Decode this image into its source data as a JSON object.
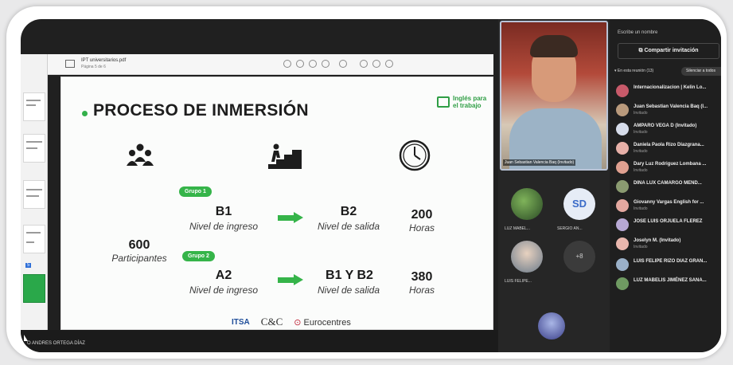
{
  "document": {
    "file_name": "IPT universitarios.pdf",
    "page_info": "Página 5 de 6"
  },
  "slide": {
    "title": "PROCESO DE INMERSIÓN",
    "brand": "Inglés para el trabajo",
    "participants_count": "600",
    "participants_label": "Participantes",
    "groups": [
      {
        "label": "Grupo 1",
        "entry_level": "B1",
        "entry_caption": "Nivel de ingreso",
        "exit_level": "B2",
        "exit_caption": "Nivel de salida",
        "hours": "200",
        "hours_caption": "Horas"
      },
      {
        "label": "Grupo 2",
        "entry_level": "A2",
        "entry_caption": "Nivel de ingreso",
        "exit_level": "B1 Y B2",
        "exit_caption": "Nivel de salida",
        "hours": "380",
        "hours_caption": "Horas"
      }
    ],
    "logos": [
      "ITSA",
      "C&C",
      "Eurocentres"
    ],
    "icons": [
      "people-group-icon",
      "stairs-climb-icon",
      "clock-icon"
    ]
  },
  "presenter": {
    "name": "O ANDRES ORTEGA DÍAZ"
  },
  "videos": {
    "main_label": "Juan Sebastian Valencia Baq (Invitado)",
    "tiles": [
      {
        "name": "LUZ MABEL..."
      },
      {
        "name": "SERGIO AN...",
        "initials": "SD"
      },
      {
        "name": "LUIS FELIPE..."
      },
      {
        "name": "",
        "initials": "+8"
      }
    ]
  },
  "participants_panel": {
    "search_placeholder": "Escribe un nombre",
    "invite_button": "Compartir invitación",
    "in_meeting": "En esta reunión (13)",
    "mute_all": "Silenciar a todos",
    "people": [
      {
        "name": "Internacionalizacion | Kelin Lo...",
        "role": ""
      },
      {
        "name": "Juan Sebastian Valencia Baq (I...",
        "role": "Invitado"
      },
      {
        "name": "AMPARO VEGA D (Invitado)",
        "role": "Invitado"
      },
      {
        "name": "Daniela Paola Rizo Diazgrana...",
        "role": "Invitado"
      },
      {
        "name": "Dary Luz Rodriguez Lombana ...",
        "role": "Invitado"
      },
      {
        "name": "DINA LUX CAMARGO MEND...",
        "role": ""
      },
      {
        "name": "Giovanny Vargas English for ...",
        "role": "Invitado"
      },
      {
        "name": "JOSE LUIS ORJUELA FLEREZ",
        "role": ""
      },
      {
        "name": "Joselyn M. (Invitado)",
        "role": "Invitado"
      },
      {
        "name": "LUIS FELIPE RIZO DIAZ GRAN...",
        "role": ""
      },
      {
        "name": "LUZ MABELIS JIMÉNEZ SANA...",
        "role": ""
      }
    ]
  },
  "colors": {
    "accent_green": "#35b449",
    "title_dark": "#1d1d1d",
    "teams_dark": "#1f1f1f"
  }
}
